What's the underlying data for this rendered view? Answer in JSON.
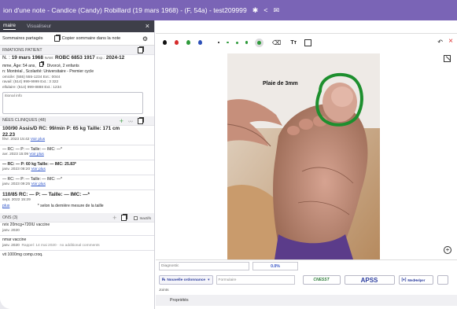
{
  "window": {
    "title": "ion d'une note - Candice (Candy) Robillard (19 mars 1968) - (F, 54a) - test209999"
  },
  "left_panel": {
    "tabs": [
      {
        "label": "maire",
        "active": true
      },
      {
        "label": "Visualiseur",
        "active": false
      }
    ],
    "toolbar": {
      "shared_summary": "Sommaires partagés",
      "copy_summary": "Copier sommaire dans la note"
    },
    "patient": {
      "header": "RMATIONS PATIENT",
      "line1_prefix": "N. :",
      "dob": "19 mars 1968",
      "nam_label": "NAM:",
      "nam": "ROBC 6853 1917",
      "exp_label": "Exp.:",
      "exp": "2024-12",
      "line2": "mme, Âge: 54 ans,",
      "line2b": "Divorcé, 2 enfants",
      "line3": "n: Montréal ,  Scolarité: Universitaire - Premier cycle",
      "line4": "omicile: (555) 555-1234 Ext.: 0044",
      "line5": "ravail: (514) 999-9999 Ext.: 3 322",
      "line6": "ellulaire: (514) 999-8888 Ext.: 1234",
      "note_placeholder": "itional info"
    },
    "clinical": {
      "header": "NÉES CLINIQUES (48)",
      "entries": [
        {
          "vitals": "100/90  Assis/D  RC: 99/min  P: 65 kg  Taille: 171 cm",
          "extra": "22.23",
          "date": "févr. 2023 15:42",
          "link": "Voir plus"
        },
        {
          "vitals": "—  RC: —  P: —  Taille: —  IMC: —*",
          "date": "avr. 2023 15:09",
          "link": "Voir plus"
        },
        {
          "vitals": "—  RC: —  P: 60 kg  Taille: —  IMC: 25.83*",
          "date": "janv. 2023 08:20",
          "link": "Voir plus"
        },
        {
          "vitals": "—  RC: —  P: —  Taille: —  IMC: —*",
          "date": "janv. 2023 09:25",
          "link": "Voir plus"
        },
        {
          "vitals": "110/85  RC: —  P: —  Taille: —  IMC: —*",
          "date": "sept. 2022 15:29"
        }
      ],
      "footer_link": "plus",
      "footer_note": "* selon la dernière mesure de la taille"
    },
    "meds": {
      "header": "ONS (3)",
      "inactive_label": "Inactifs",
      "items": [
        {
          "name": "nrix 20mcg+720IU vaccine",
          "date": "janv. 2020"
        },
        {
          "name": "nmar vaccine",
          "date": "janv. 2020",
          "extra": "Rappel: 14 mai 2020  · no additional comments"
        },
        {
          "name": "vit 1000mg comp.croq.",
          "date": ""
        }
      ]
    }
  },
  "right_panel": {
    "photo_label": "Plaie de 3mm",
    "colors": {
      "black": "#111111",
      "red": "#d62b2b",
      "green": "#2e9a3a",
      "blue": "#2c4fb8",
      "annotation": "#1d8f2e",
      "purple": "#7a64b6"
    },
    "diagnosis_placeholder": "Diagnostic",
    "diagnosis_code": "0.0%",
    "new_prescription": "Nouvelle ordonnance",
    "form_placeholder": "Formulaire",
    "logos": [
      "CNESST",
      "APSS",
      "MedHelper"
    ],
    "joints_label": "Joints",
    "properties_label": "Propriétés"
  }
}
